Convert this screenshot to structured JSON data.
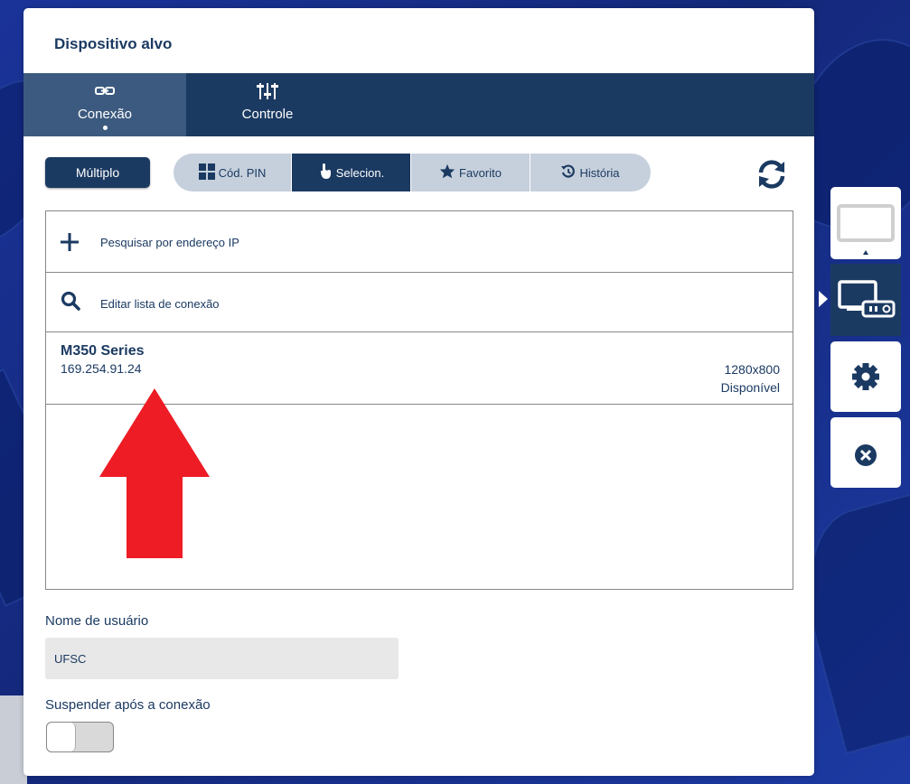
{
  "panel": {
    "title": "Dispositivo alvo"
  },
  "tabs": [
    {
      "label": "Conexão",
      "icon": "link-icon",
      "active": true
    },
    {
      "label": "Controle",
      "icon": "sliders-icon",
      "active": false
    }
  ],
  "mode_button": {
    "label": "Múltiplo"
  },
  "search_methods": [
    {
      "label": "Cód. PIN",
      "icon": "grid-icon",
      "active": false
    },
    {
      "label": "Selecion.",
      "icon": "pointer-hand-icon",
      "active": true
    },
    {
      "label": "Favorito",
      "icon": "star-icon",
      "active": false
    },
    {
      "label": "História",
      "icon": "history-icon",
      "active": false
    }
  ],
  "refresh": {
    "icon": "refresh-icon"
  },
  "list": {
    "search_ip_label": "Pesquisar por endereço IP",
    "edit_list_label": "Editar lista de conexão",
    "devices": [
      {
        "name": "M350 Series",
        "ip": "169.254.91.24",
        "resolution": "1280x800",
        "status": "Disponível"
      }
    ]
  },
  "user": {
    "label": "Nome de usuário",
    "value": "UFSC"
  },
  "suspend": {
    "label": "Suspender após a conexão",
    "enabled": false
  },
  "sidebar": [
    {
      "icon": "display-icon",
      "active": false
    },
    {
      "icon": "monitor-projector-icon",
      "active": true
    },
    {
      "icon": "gear-icon",
      "active": false
    },
    {
      "icon": "close-circle-icon",
      "active": false
    }
  ],
  "colors": {
    "primary": "#1b3a62",
    "tab_active": "#3c5a7f",
    "segment_bg": "#c6d0dc",
    "arrow": "#ee1c25"
  }
}
